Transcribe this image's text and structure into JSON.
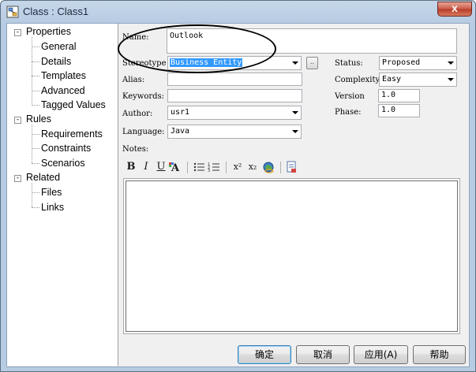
{
  "window": {
    "title": "Class : Class1",
    "close_glyph": "x"
  },
  "tree": {
    "groups": [
      {
        "label": "Properties",
        "expander": "-",
        "children": [
          "General",
          "Details",
          "Templates",
          "Advanced",
          "Tagged Values"
        ]
      },
      {
        "label": "Rules",
        "expander": "-",
        "children": [
          "Requirements",
          "Constraints",
          "Scenarios"
        ]
      },
      {
        "label": "Related",
        "expander": "-",
        "children": [
          "Files",
          "Links"
        ]
      }
    ]
  },
  "form": {
    "name_label": "Name:",
    "name_value": "Outlook",
    "stereotype_label": "Stereotype",
    "stereotype_value": "Business Entity",
    "stereotype_button": "..",
    "alias_label": "Alias:",
    "alias_value": "",
    "keywords_label": "Keywords:",
    "keywords_value": "",
    "author_label": "Author:",
    "author_value": "usr1",
    "language_label": "Language:",
    "language_value": "Java",
    "notes_label": "Notes:",
    "status_label": "Status:",
    "status_value": "Proposed",
    "complexity_label": "Complexity",
    "complexity_value": "Easy",
    "version_label": "Version",
    "version_value": "1.0",
    "phase_label": "Phase:",
    "phase_value": "1.0"
  },
  "notes_toolbar": {
    "bold": "B",
    "italic": "I",
    "underline": "U",
    "superscript": "x²",
    "subscript": "x₂"
  },
  "buttons": {
    "ok": "确定",
    "cancel": "取消",
    "apply": "应用(A)",
    "help": "帮助"
  },
  "colors": {
    "selection": "#3399ff",
    "title_bar": "#b7cbe2",
    "close_button": "#c95a48"
  }
}
